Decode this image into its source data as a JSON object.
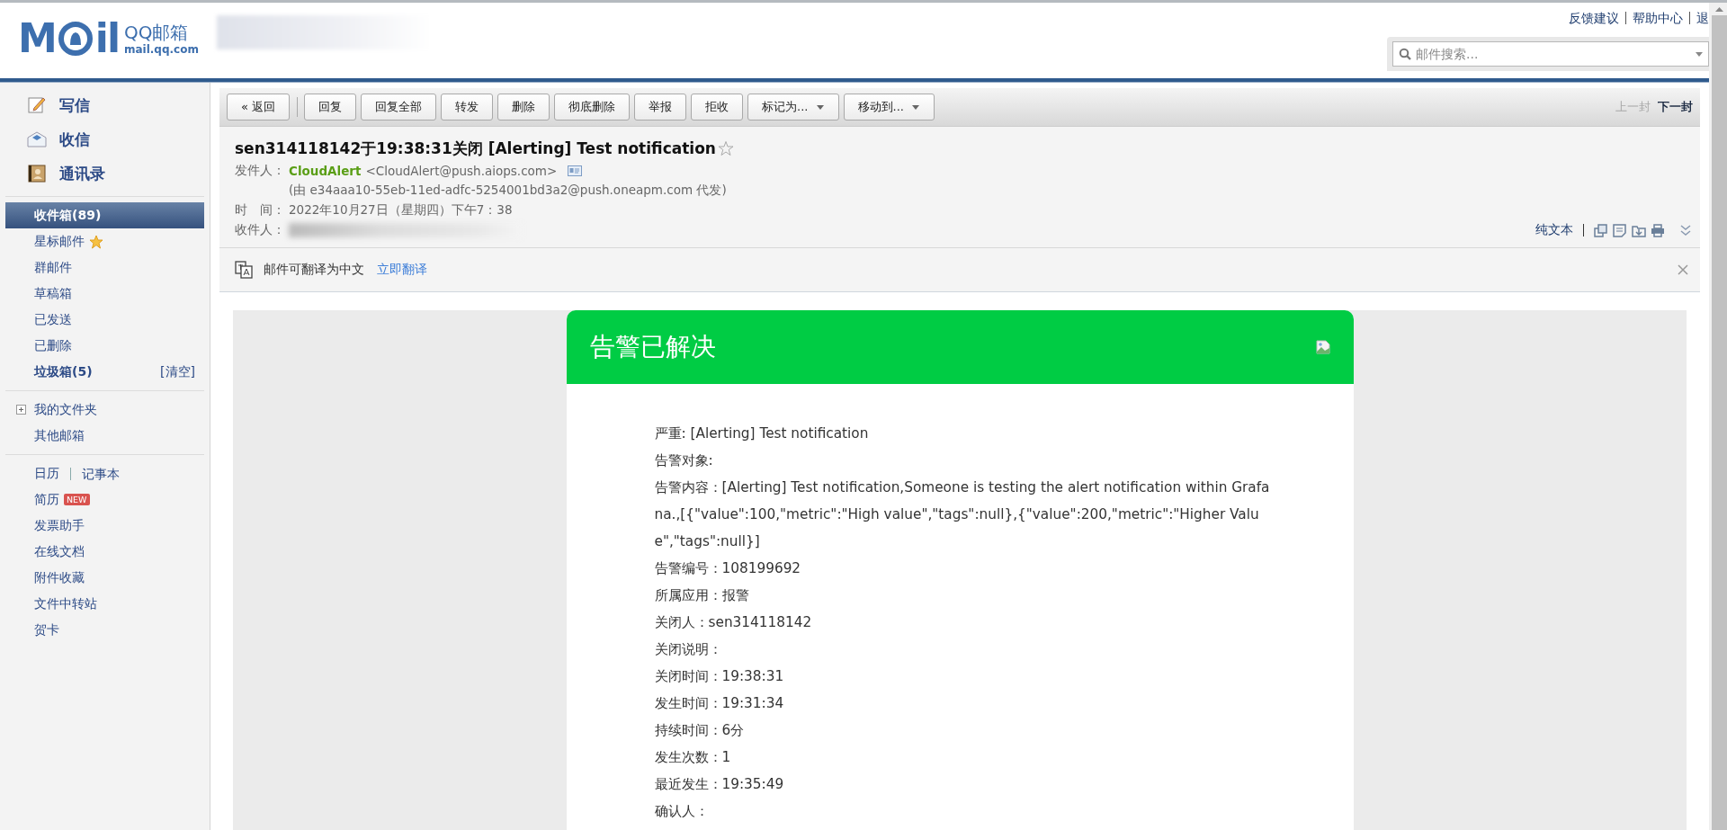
{
  "header": {
    "logo_letters": [
      "M",
      "il"
    ],
    "logo_text": "QQ邮箱",
    "logo_domain": "mail.qq.com",
    "links": [
      "反馈建议",
      "帮助中心",
      "退"
    ],
    "search": {
      "placeholder": "邮件搜索..."
    }
  },
  "sidebar": {
    "actions": [
      {
        "label": "写信",
        "kind": "compose"
      },
      {
        "label": "收信",
        "kind": "receive"
      },
      {
        "label": "通讯录",
        "kind": "contacts"
      }
    ],
    "folders": [
      {
        "label": "收件箱(89)",
        "selected": true,
        "bold": true
      },
      {
        "label": "星标邮件",
        "selected": false,
        "bold": false,
        "starred": true
      },
      {
        "label": "群邮件",
        "selected": false,
        "bold": false
      },
      {
        "label": "草稿箱",
        "selected": false,
        "bold": false
      },
      {
        "label": "已发送",
        "selected": false,
        "bold": false
      },
      {
        "label": "已删除",
        "selected": false,
        "bold": false
      },
      {
        "label": "垃圾箱(5)",
        "selected": false,
        "bold": true,
        "action": "[清空]"
      }
    ],
    "groups": [
      {
        "label": "我的文件夹",
        "expandable": true
      },
      {
        "label": "其他邮箱"
      }
    ],
    "calendar_row": [
      "日历",
      "记事本"
    ],
    "tools": [
      {
        "label": "简历",
        "badge": "NEW"
      },
      {
        "label": "发票助手"
      },
      {
        "label": "在线文档"
      },
      {
        "label": "附件收藏"
      },
      {
        "label": "文件中转站"
      },
      {
        "label": "贺卡"
      }
    ]
  },
  "toolbar": {
    "buttons": [
      {
        "label": "« 返回",
        "kind": "back"
      },
      {
        "label": "回复",
        "kind": "plain"
      },
      {
        "label": "回复全部",
        "kind": "plain"
      },
      {
        "label": "转发",
        "kind": "plain"
      },
      {
        "label": "删除",
        "kind": "plain"
      },
      {
        "label": "彻底删除",
        "kind": "plain"
      },
      {
        "label": "举报",
        "kind": "plain"
      },
      {
        "label": "拒收",
        "kind": "plain"
      },
      {
        "label": "标记为...",
        "kind": "dropdown"
      },
      {
        "label": "移动到...",
        "kind": "dropdown"
      }
    ],
    "nav": [
      {
        "label": "上一封",
        "disabled": true
      },
      {
        "label": "下一封",
        "disabled": false
      }
    ]
  },
  "mail": {
    "subject": "sen314118142于19:38:31关闭 [Alerting] Test notification",
    "starred": false,
    "from_label": "发件人：",
    "sender_name": "CloudAlert",
    "sender_address": "<CloudAlert@push.aiops.com>",
    "proxy": "(由 e34aaa10-55eb-11ed-adfc-5254001bd3a2@push.oneapm.com 代发)",
    "time_label": "时　间：",
    "time": "2022年10月27日（星期四）下午7：38",
    "to_label": "收件人：",
    "view_link": "纯文本"
  },
  "translate_bar": {
    "text": "邮件可翻译为中文",
    "link": "立即翻译"
  },
  "card": {
    "title": "告警已解决",
    "rows": [
      "严重: [Alerting] Test notification",
      "告警对象:",
      "告警内容：[Alerting] Test notification,Someone is testing the alert notification within Grafana.,[{\"value\":100,\"metric\":\"High value\",\"tags\":null},{\"value\":200,\"metric\":\"Higher Value\",\"tags\":null}]",
      "告警编号：108199692",
      "所属应用：报警",
      "关闭人：sen314118142",
      "关闭说明：",
      "关闭时间：19:38:31",
      "发生时间：19:31:34",
      "持续时间：6分",
      "发生次数：1",
      "最近发生：19:35:49",
      "确认人："
    ]
  }
}
